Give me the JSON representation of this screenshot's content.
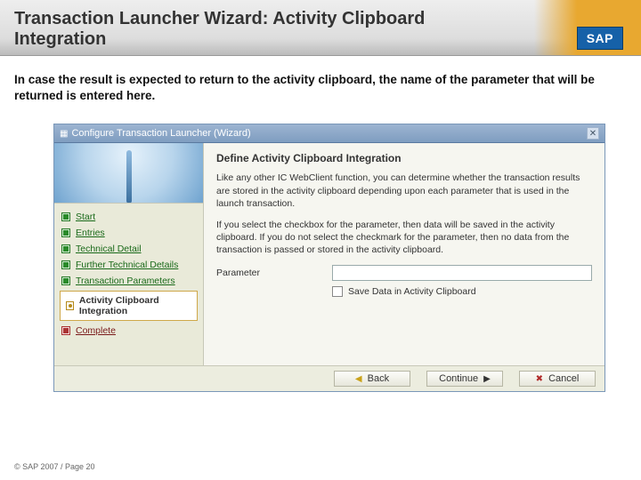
{
  "header": {
    "title": "Transaction Launcher Wizard: Activity Clipboard Integration",
    "logo_text": "SAP"
  },
  "intro": "In case the result is expected to return to the activity clipboard, the name of the parameter that will be returned is entered here.",
  "wizard": {
    "window_title": "Configure Transaction Launcher (Wizard)",
    "main_heading": "Define Activity Clipboard Integration",
    "para1": "Like any other IC WebClient function, you can determine whether the transaction results are stored in the activity clipboard depending upon each parameter that is used in the launch transaction.",
    "para2": "If you select the checkbox for the parameter, then data will be saved in the activity clipboard. If you do not select the checkmark for the parameter, then no data from the transaction is passed or stored in the activity clipboard.",
    "field_label": "Parameter",
    "field_value": "",
    "checkbox_label": "Save Data in Activity Clipboard",
    "steps": {
      "s1": "Start",
      "s2": "Entries",
      "s3": "Technical Detail",
      "s4": "Further Technical Details",
      "s5": "Transaction Parameters",
      "s6": "Activity Clipboard Integration",
      "s7": "Complete"
    },
    "buttons": {
      "back": "Back",
      "continue": "Continue",
      "cancel": "Cancel"
    }
  },
  "footer": {
    "copyright": "© SAP 2007 / Page 20"
  }
}
